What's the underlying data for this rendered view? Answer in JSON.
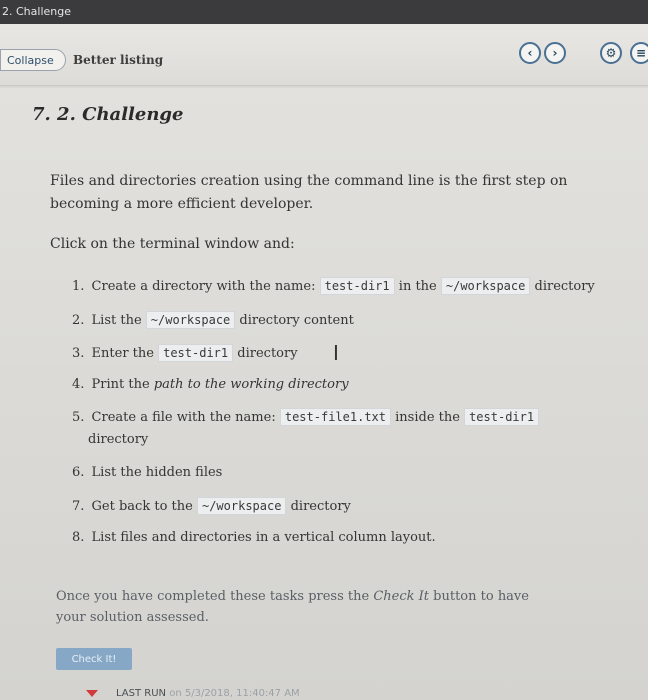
{
  "window": {
    "title": "2. Challenge"
  },
  "toolbar": {
    "collapse_label": "Collapse",
    "breadcrumb": "Better listing",
    "prev_icon": "chevron-left-icon",
    "next_icon": "chevron-right-icon",
    "settings_icon": "gear-icon",
    "more_icon": "menu-icon"
  },
  "content": {
    "heading": "7. 2. Challenge",
    "intro": "Files and directories creation using the command line is the first step on becoming a more efficient developer.",
    "click_line": "Click on the terminal window and:",
    "tasks": [
      {
        "num": "1.",
        "t1": "Create a directory with the name:",
        "c1": "test-dir1",
        "t2": "in the",
        "c2": "~/workspace",
        "t3": "directory"
      },
      {
        "num": "2.",
        "t1": "List the",
        "c1": "~/workspace",
        "t2": "directory content"
      },
      {
        "num": "3.",
        "t1": "Enter the",
        "c1": "test-dir1",
        "t2": "directory"
      },
      {
        "num": "4.",
        "t1": "Print the",
        "i1": "path to the working directory"
      },
      {
        "num": "5.",
        "t1": "Create a file with the name:",
        "c1": "test-file1.txt",
        "t2": "inside the",
        "c2": "test-dir1",
        "t3": "directory"
      },
      {
        "num": "6.",
        "t1": "List the hidden files"
      },
      {
        "num": "7.",
        "t1": "Get back to the",
        "c1": "~/workspace",
        "t2": "directory"
      },
      {
        "num": "8.",
        "t1": "List files and directories in a vertical column layout."
      }
    ],
    "footer_a": "Once you have completed these tasks press the",
    "footer_em": "Check It",
    "footer_b": "button to have your solution assessed.",
    "check_button": "Check It!",
    "last_run_label": "LAST RUN",
    "last_run_value": "on 5/3/2018, 11:40:47 AM"
  },
  "colors": {
    "title_bar": "#3b3b3d",
    "accent_circle": "#4a7094",
    "check_button": "#86a8c6",
    "status_marker": "#d23b3b"
  }
}
